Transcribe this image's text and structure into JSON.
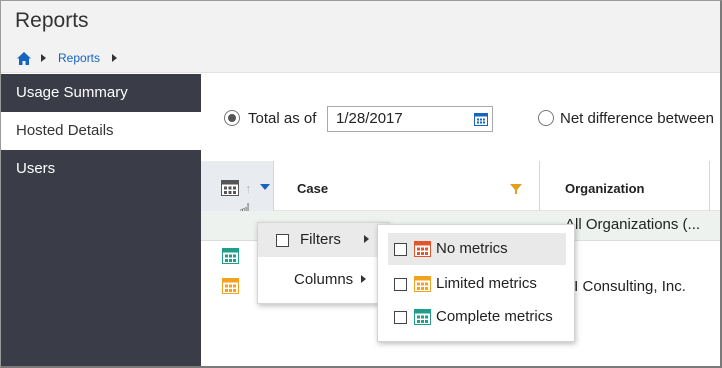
{
  "window": {
    "title": "Reports"
  },
  "breadcrumb": {
    "items": [
      "Reports"
    ]
  },
  "sidebar": {
    "items": [
      {
        "label": "Usage Summary",
        "active": false
      },
      {
        "label": "Hosted Details",
        "active": true
      },
      {
        "label": "Users",
        "active": false
      }
    ]
  },
  "toolbar": {
    "total_label": "Total as of",
    "date_value": "1/28/2017",
    "net_label": "Net difference between"
  },
  "grid": {
    "columns": {
      "case": "Case",
      "organization": "Organization"
    },
    "filter_row": {
      "organization": "All Organizations (..."
    },
    "rows": [
      {
        "icon": "calendar-green-icon",
        "organization": ""
      },
      {
        "icon": "calendar-orange-icon",
        "organization": "TI Consulting, Inc."
      }
    ]
  },
  "context_menu": {
    "items": [
      {
        "label": "Filters",
        "has_checkbox": true,
        "has_submenu": true
      },
      {
        "label": "Columns",
        "has_checkbox": false,
        "has_submenu": true
      }
    ]
  },
  "filters_submenu": {
    "items": [
      {
        "label": "No metrics",
        "icon": "calendar-red-icon",
        "color": "#e0552b",
        "checked": false
      },
      {
        "label": "Limited metrics",
        "icon": "calendar-orange-icon",
        "color": "#f3a21f",
        "checked": false
      },
      {
        "label": "Complete metrics",
        "icon": "calendar-teal-icon",
        "color": "#1f9e8a",
        "checked": false
      }
    ]
  },
  "colors": {
    "sidebar_bg": "#3a3d47",
    "link": "#1565c0",
    "accent_filter": "#e3a01a"
  }
}
